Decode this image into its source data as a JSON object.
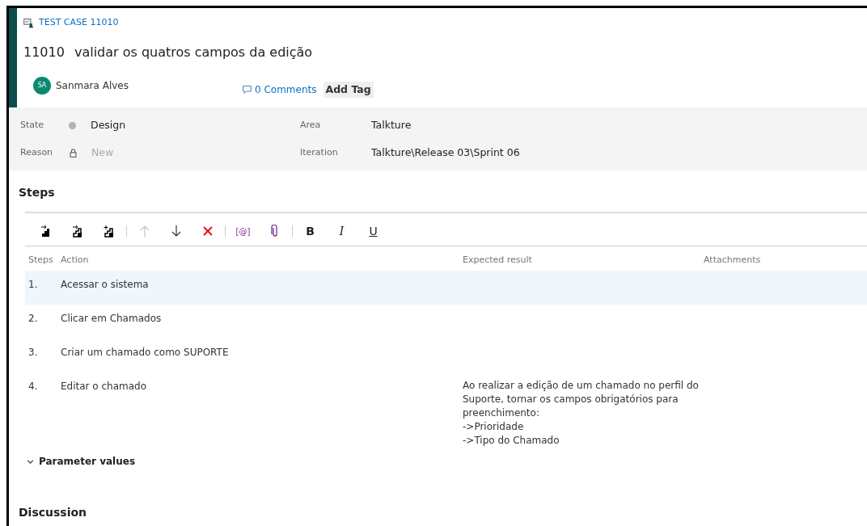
{
  "header": {
    "type_label": "TEST CASE 11010",
    "id": "11010",
    "title": "validar os quatros campos da edição",
    "author": {
      "initials": "SA",
      "name": "Sanmara Alves"
    },
    "comments": "0 Comments",
    "add_tag": "Add Tag"
  },
  "fields": [
    {
      "label": "State",
      "value": "Design",
      "kind": "state",
      "color": "#b2b2b2",
      "disabled": false
    },
    {
      "label": "Area",
      "value": "Talkture",
      "kind": "plain",
      "disabled": false
    },
    {
      "label": "Reason",
      "value": "New",
      "kind": "locked",
      "disabled": true
    },
    {
      "label": "Iteration",
      "value": "Talkture\\Release 03\\Sprint 06",
      "kind": "plain",
      "disabled": false
    }
  ],
  "steps_heading": "Steps",
  "toolbar": [
    {
      "kind": "insert",
      "disabled": false
    },
    {
      "kind": "insert-shared",
      "disabled": false
    },
    {
      "kind": "create-shared",
      "disabled": false
    },
    {
      "kind": "separator"
    },
    {
      "kind": "up",
      "disabled": true
    },
    {
      "kind": "down",
      "disabled": false
    },
    {
      "kind": "delete",
      "disabled": false
    },
    {
      "kind": "separator"
    },
    {
      "kind": "parameter",
      "label": "[@]",
      "disabled": false
    },
    {
      "kind": "attach",
      "disabled": false
    },
    {
      "kind": "separator"
    },
    {
      "kind": "bold",
      "label": "B",
      "disabled": false
    },
    {
      "kind": "italic",
      "label": "I",
      "disabled": false
    },
    {
      "kind": "underline",
      "label": "U",
      "disabled": false
    }
  ],
  "table": {
    "columns": [
      "Steps",
      "Action",
      "Expected result",
      "Attachments"
    ],
    "rows": [
      {
        "step": "1.",
        "action": "Acessar o sistema",
        "selected": true
      },
      {
        "step": "2.",
        "action": "Clicar em Chamados",
        "selected": false
      },
      {
        "step": "3.",
        "action": "Criar um chamado como SUPORTE",
        "selected": false
      },
      {
        "step": "4.",
        "action": "Editar o chamado",
        "expected": "Ao realizar a edição de um chamado no perfil do\nSuporte, tornar os campos obrigatórios para\npreenchimento:\n->Prioridade\n->Tipo do Chamado",
        "selected": false
      }
    ]
  },
  "parameter_values": {
    "label": "Parameter values",
    "expanded": true
  },
  "discussion_heading": "Discussion"
}
